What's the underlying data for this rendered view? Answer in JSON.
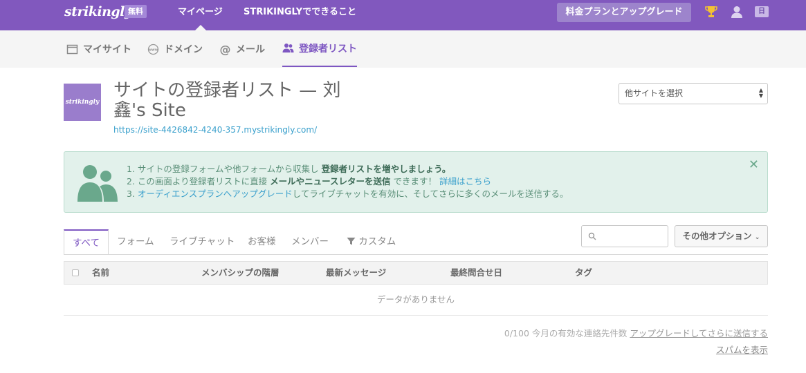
{
  "topbar": {
    "logo": "strikingly",
    "badge": "無料",
    "nav_mypage": "マイページ",
    "nav_features": "STRIKINGLYでできること",
    "upgrade_button": "料金プランとアップグレード",
    "lang": "日",
    "color": "#8158be"
  },
  "subnav": {
    "items": [
      {
        "label": "マイサイト",
        "icon": "browser-window-icon"
      },
      {
        "label": "ドメイン",
        "icon": "www-globe-icon"
      },
      {
        "label": "メール",
        "icon": "at-icon"
      },
      {
        "label": "登録者リスト",
        "icon": "people-icon",
        "active": true
      }
    ]
  },
  "header": {
    "thumb_text": "strikingly",
    "title": "サイトの登録者リスト — 刘鑫's Site",
    "url": "https://site-4426842-4240-357.mystrikingly.com/",
    "site_select": "他サイトを選択"
  },
  "info": {
    "line1_prefix": "1. サイトの登録フォームや他フォームから収集し ",
    "line1_bold": "登録者リストを増やしましょう。",
    "line2_prefix": "2. この画面より登録者リストに直接 ",
    "line2_bold": "メールやニュースレターを送信",
    "line2_mid": " できます！ ",
    "line2_link": "詳細はこちら",
    "line3_prefix": "3. ",
    "line3_link": "オーディエンスプランへアップグレード",
    "line3_suffix": "してライブチャットを有効に、そしてさらに多くのメールを送信する。"
  },
  "tabs": {
    "all": "すべて",
    "form": "フォーム",
    "livechat": "ライブチャット",
    "customers": "お客様",
    "members": "メンバー",
    "custom": "カスタム"
  },
  "toolbar": {
    "search_placeholder": "",
    "more_options": "その他オプション"
  },
  "table": {
    "columns": [
      "名前",
      "メンバシップの階層",
      "最新メッセージ",
      "最終問合せ日",
      "タグ"
    ],
    "empty": "データがありません"
  },
  "footer": {
    "quota_text": "0/100 今月の有効な連絡先件数 ",
    "quota_link": "アップグレードしてさらに送信する",
    "spam_link": "スパムを表示"
  }
}
